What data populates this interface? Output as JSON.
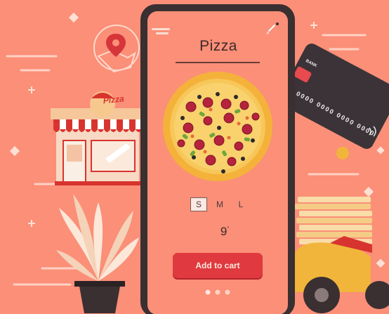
{
  "app": {
    "title": "Pizza"
  },
  "size_selector": {
    "options": [
      "S",
      "M",
      "L"
    ],
    "selected": "S"
  },
  "size_value": "9",
  "size_unit": "\"",
  "add_to_cart_label": "Add to cart",
  "card": {
    "bank_label": "BANK",
    "number": "0000  0000  0000  0000"
  },
  "store": {
    "sign": "Pizza"
  },
  "pager": {
    "count": 3,
    "active": 0
  },
  "colors": {
    "background": "#fb8f78",
    "phone_body": "#3a2f31",
    "phone_screen": "#fb8f78",
    "accent": "#e0393f",
    "pizza_crust": "#f4b23a",
    "card": "#3b3337"
  }
}
